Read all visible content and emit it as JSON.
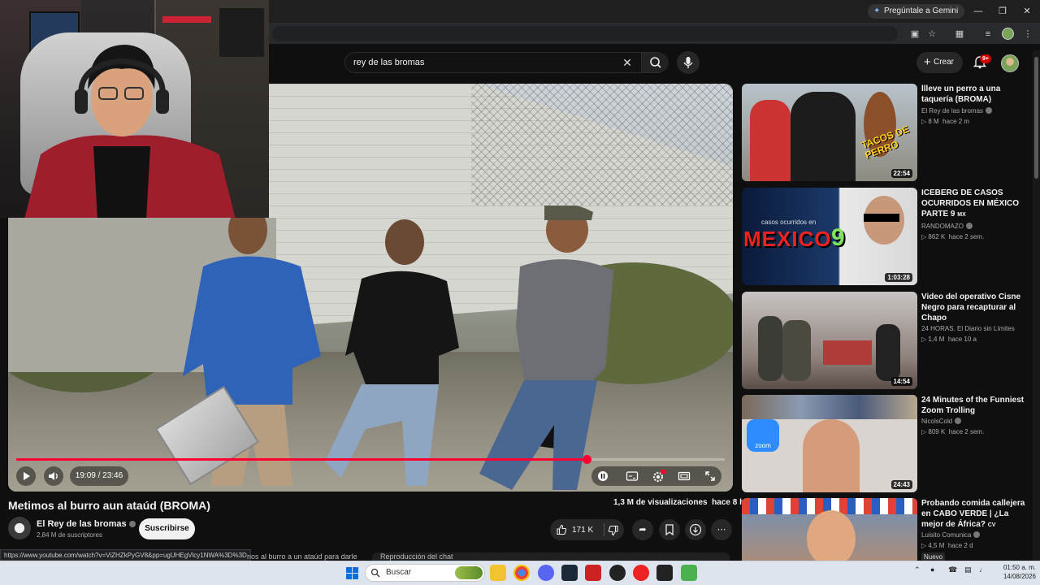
{
  "browser": {
    "gemini_button": "Pregúntale a Gemini",
    "window_controls": [
      "minimize-icon",
      "restore-icon",
      "close-icon"
    ]
  },
  "header": {
    "search_value": "rey de las bromas",
    "create_label": "Crear",
    "notifications_badge": "9+"
  },
  "player": {
    "current_time": "19:09",
    "duration": "23:46",
    "time_display": "19:09 / 23:46",
    "progress": 0.805
  },
  "video": {
    "title": "Metimos al burro aun ataúd (BROMA)",
    "views": "1,3 M de visualizaciones",
    "age": "hace 8 h",
    "channel_name": "El Rey de las bromas",
    "subscribers": "2,84 M de suscriptores",
    "subscribe_label": "Suscribirse",
    "likes": "171 K"
  },
  "status_url": "https://www.youtube.com/watch?v=ViZHZkPyGV8&pp=ugUHEgVlcy1NWA%3D%3D",
  "below_chips": {
    "chapter_text": "nos al burro a un ataúd para darle",
    "chat_text": "Reproducción del chat"
  },
  "recommendations": [
    {
      "title": "llleve un perro a una taquería (BROMA)",
      "channel": "El Rey de las bromas",
      "views": "8 M",
      "age": "hace 2 m",
      "duration": "22:54",
      "thumb_text": "TACOS DE PERRO"
    },
    {
      "title": "ICEBERG DE CASOS OCURRIDOS EN MÉXICO PARTE 9",
      "title_suffix": "MX",
      "channel": "RANDOMAZO",
      "views": "862 K",
      "age": "hace 2 sem.",
      "duration": "1:03:28",
      "thumb_text": "MEXICO",
      "thumb_sub": "casos ocurridos en",
      "thumb_num": "9"
    },
    {
      "title": "Video del operativo Cisne Negro para recapturar al Chapo",
      "channel": "24 HORAS. El Diario sin Límites",
      "views": "1,4 M",
      "age": "hace 10 a",
      "duration": "14:54"
    },
    {
      "title": "24 Minutes of the Funniest Zoom Trolling",
      "channel": "NicolsCold",
      "views": "809 K",
      "age": "hace 2 sem.",
      "duration": "24:43",
      "thumb_text": "zoom"
    },
    {
      "title": "Probando comida callejera en CABO VERDE | ¿La mejor de África?",
      "title_suffix": "CV",
      "channel": "Luisito Comunica",
      "views": "4,5 M",
      "age": "hace 2 d",
      "badge": "Nuevo"
    }
  ],
  "taskbar": {
    "search_placeholder": "Buscar",
    "time": "01:50 a. m.",
    "date": "14/08/2026"
  },
  "colors": {
    "accent_red": "#ff0033",
    "background": "#0f0f0f",
    "taskbar": "#dde4ee"
  }
}
